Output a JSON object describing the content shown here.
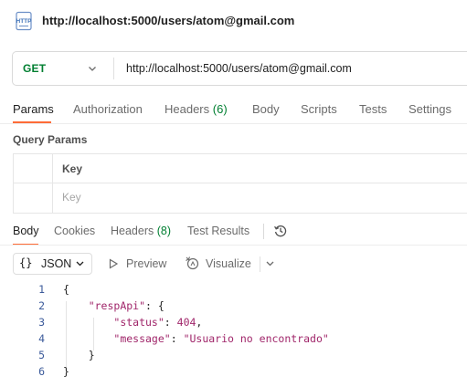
{
  "title": {
    "url": "http://localhost:5000/users/atom@gmail.com"
  },
  "request": {
    "method": "GET",
    "url": "http://localhost:5000/users/atom@gmail.com"
  },
  "request_tabs": [
    {
      "label": "Params",
      "active": true
    },
    {
      "label": "Authorization"
    },
    {
      "label": "Headers",
      "count": "(6)"
    },
    {
      "label": "Body"
    },
    {
      "label": "Scripts"
    },
    {
      "label": "Tests"
    },
    {
      "label": "Settings"
    }
  ],
  "query_params": {
    "title": "Query Params",
    "key_header": "Key",
    "key_placeholder": "Key"
  },
  "response_tabs": [
    {
      "label": "Body",
      "active": true
    },
    {
      "label": "Cookies"
    },
    {
      "label": "Headers",
      "count": "(8)"
    },
    {
      "label": "Test Results"
    }
  ],
  "toolbar": {
    "format_braces": "{}",
    "format": "JSON",
    "preview": "Preview",
    "visualize": "Visualize"
  },
  "code": {
    "line_numbers": [
      "1",
      "2",
      "3",
      "4",
      "5",
      "6"
    ],
    "lines": [
      {
        "parts": [
          {
            "t": "{"
          }
        ]
      },
      {
        "parts": [
          {
            "t": "    "
          },
          {
            "t": "\"respApi\"",
            "c": "k"
          },
          {
            "t": ": {"
          }
        ]
      },
      {
        "parts": [
          {
            "t": "        "
          },
          {
            "t": "\"status\"",
            "c": "k"
          },
          {
            "t": ": "
          },
          {
            "t": "404",
            "c": "n"
          },
          {
            "t": ","
          }
        ]
      },
      {
        "parts": [
          {
            "t": "        "
          },
          {
            "t": "\"message\"",
            "c": "k"
          },
          {
            "t": ": "
          },
          {
            "t": "\"Usuario no encontrado\"",
            "c": "s"
          }
        ]
      },
      {
        "parts": [
          {
            "t": "    }"
          }
        ]
      },
      {
        "parts": [
          {
            "t": "}"
          }
        ]
      }
    ]
  },
  "colors": {
    "accent": "#ff6c37",
    "method_get": "#007f31",
    "json_key": "#a0266a",
    "line_number": "#3b5a9a"
  },
  "icons": {
    "http": "http-file-icon",
    "method_dropdown": "chevron-down-icon",
    "history": "history-icon",
    "preview": "play-icon",
    "visualize": "visualize-icon"
  }
}
